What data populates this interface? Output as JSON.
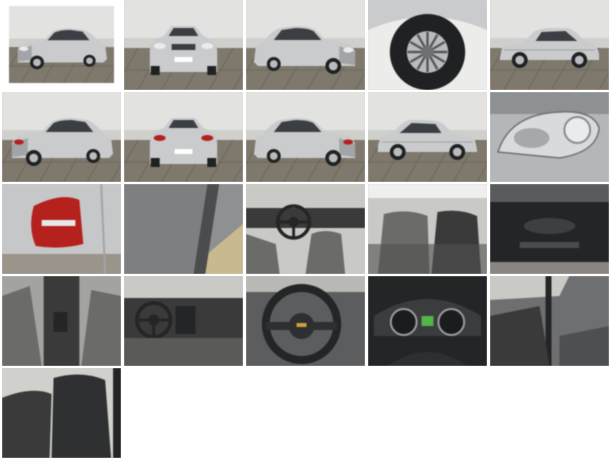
{
  "gallery": {
    "colors": {
      "page_bg": "#ffffff",
      "wall": "#e2e2e0",
      "wall_shade": "#cfcfcc",
      "floor": "#7f786c",
      "floor_line": "#6a645a",
      "car_body": "#c9cbcc",
      "car_shade": "#a2a5a7",
      "glass": "#3b3f44",
      "tire": "#1f2123",
      "rim": "#b9bcbf",
      "headlight": "#e9ecee",
      "taillight": "#b5211d",
      "interior": "#3a3a3a",
      "interior_dark": "#242526",
      "interior_light": "#6b6b69",
      "window_light": "#c9c9c6",
      "trim": "#8e8e8c",
      "cluster_accent": "#53b54a",
      "mat": "#c9b98e"
    },
    "thumbnails": [
      {
        "icon": "car-front-three-quarter-photo"
      },
      {
        "icon": "car-front-photo"
      },
      {
        "icon": "car-front-three-quarter-right-photo"
      },
      {
        "icon": "wheel-photo"
      },
      {
        "icon": "car-side-photo"
      },
      {
        "icon": "car-rear-three-quarter-photo"
      },
      {
        "icon": "car-rear-photo"
      },
      {
        "icon": "car-rear-three-quarter-right-photo"
      },
      {
        "icon": "car-side-left-photo"
      },
      {
        "icon": "headlight-photo"
      },
      {
        "icon": "taillight-photo"
      },
      {
        "icon": "door-sill-photo"
      },
      {
        "icon": "interior-front-photo"
      },
      {
        "icon": "interior-rear-photo"
      },
      {
        "icon": "dashboard-top-photo"
      },
      {
        "icon": "center-console-photo"
      },
      {
        "icon": "dashboard-photo"
      },
      {
        "icon": "steering-wheel-photo"
      },
      {
        "icon": "instrument-cluster-photo"
      },
      {
        "icon": "door-interior-photo"
      },
      {
        "icon": "front-seat-photo"
      }
    ]
  }
}
